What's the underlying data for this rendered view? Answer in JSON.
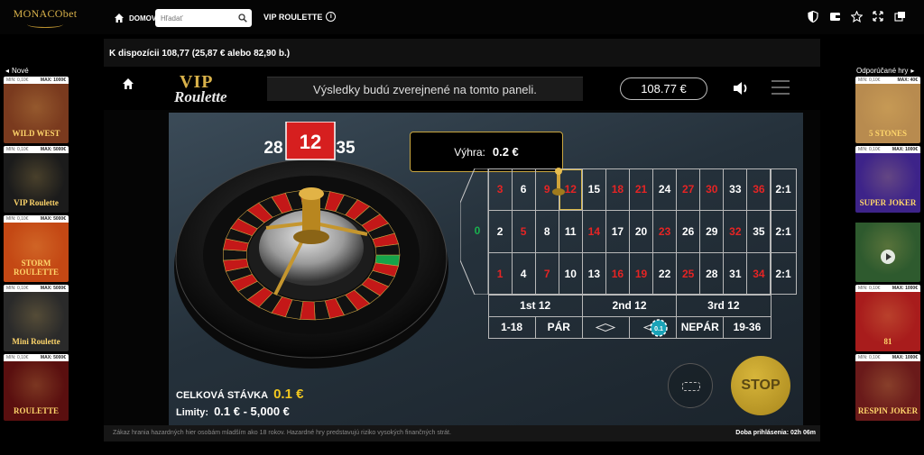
{
  "topbar": {
    "logo_text": "MONACObet",
    "home_label": "DOMOV",
    "search_placeholder": "Hľadať",
    "game_title": "VIP ROULETTE",
    "info_glyph": "i"
  },
  "balance_bar": {
    "text": "K dispozícii 108,77 (25,87 € alebo 82,90 b.)"
  },
  "left_rail": {
    "heading": "Nové",
    "tiles": [
      {
        "min": "MIN: 0,10€",
        "max": "MAX: 1000€",
        "title": "WILD WEST",
        "bg": "#7a3a1e"
      },
      {
        "min": "MIN: 0,10€",
        "max": "MAX: 5000€",
        "title": "VIP Roulette",
        "bg": "#1b1b1b"
      },
      {
        "min": "MIN: 0,10€",
        "max": "MAX: 5000€",
        "title": "STORM ROULETTE",
        "bg": "#c44814"
      },
      {
        "min": "MIN: 0,10€",
        "max": "MAX: 5000€",
        "title": "Mini Roulette",
        "bg": "#2a2a2a"
      },
      {
        "min": "MIN: 0,10€",
        "max": "MAX: 5000€",
        "title": "ROULETTE",
        "bg": "#5a0f0f"
      }
    ]
  },
  "right_rail": {
    "heading": "Odporúčané hry",
    "tiles": [
      {
        "min": "MIN: 0,10€",
        "max": "MAX: 40€",
        "title": "5 STONES",
        "bg": "#b88b4f"
      },
      {
        "min": "MIN: 0,10€",
        "max": "MAX: 1000€",
        "title": "SUPER JOKER",
        "bg": "#3d2389"
      },
      {
        "min": "",
        "max": "",
        "title": "",
        "bg": "#2e5a2e"
      },
      {
        "min": "MIN: 0,10€",
        "max": "MAX: 1000€",
        "title": "81",
        "bg": "#a81c1c"
      },
      {
        "min": "MIN: 0,10€",
        "max": "MAX: 1000€",
        "title": "RESPIN JOKER",
        "bg": "#6a1a1a"
      }
    ]
  },
  "game": {
    "logo_line1": "VIP",
    "logo_line2": "Roulette",
    "message": "Výsledky budú zverejnené na tomto paneli.",
    "balance": "108.77 €",
    "win_label": "Výhra:",
    "win_value": "0.2 €",
    "last_number": "12",
    "prev_number": "28",
    "next_number": "35",
    "total_bet_label": "CELKOVÁ STÁVKA",
    "total_bet_value": "0.1 €",
    "limits_label": "Limity:",
    "limits_value": "0.1 € - 5,000 €",
    "stop_label": "STOP",
    "chip_value": "0.1"
  },
  "table": {
    "zero": "0",
    "rows": [
      [
        {
          "n": "3",
          "c": "red"
        },
        {
          "n": "6",
          "c": "black"
        },
        {
          "n": "9",
          "c": "red"
        },
        {
          "n": "12",
          "c": "red"
        },
        {
          "n": "15",
          "c": "black"
        },
        {
          "n": "18",
          "c": "red"
        },
        {
          "n": "21",
          "c": "red"
        },
        {
          "n": "24",
          "c": "black"
        },
        {
          "n": "27",
          "c": "red"
        },
        {
          "n": "30",
          "c": "red"
        },
        {
          "n": "33",
          "c": "black"
        },
        {
          "n": "36",
          "c": "red"
        }
      ],
      [
        {
          "n": "2",
          "c": "black"
        },
        {
          "n": "5",
          "c": "red"
        },
        {
          "n": "8",
          "c": "black"
        },
        {
          "n": "11",
          "c": "black"
        },
        {
          "n": "14",
          "c": "red"
        },
        {
          "n": "17",
          "c": "black"
        },
        {
          "n": "20",
          "c": "black"
        },
        {
          "n": "23",
          "c": "red"
        },
        {
          "n": "26",
          "c": "black"
        },
        {
          "n": "29",
          "c": "black"
        },
        {
          "n": "32",
          "c": "red"
        },
        {
          "n": "35",
          "c": "black"
        }
      ],
      [
        {
          "n": "1",
          "c": "red"
        },
        {
          "n": "4",
          "c": "black"
        },
        {
          "n": "7",
          "c": "red"
        },
        {
          "n": "10",
          "c": "black"
        },
        {
          "n": "13",
          "c": "black"
        },
        {
          "n": "16",
          "c": "red"
        },
        {
          "n": "19",
          "c": "red"
        },
        {
          "n": "22",
          "c": "black"
        },
        {
          "n": "25",
          "c": "red"
        },
        {
          "n": "28",
          "c": "black"
        },
        {
          "n": "31",
          "c": "black"
        },
        {
          "n": "34",
          "c": "red"
        }
      ]
    ],
    "columns": [
      "2:1",
      "2:1",
      "2:1"
    ],
    "dozens": [
      "1st 12",
      "2nd 12",
      "3rd 12"
    ],
    "evens": [
      "1-18",
      "PÁR",
      "",
      "",
      "NEPÁR",
      "19-36"
    ]
  },
  "footer": {
    "warning": "Zákaz hrania hazardných hier osobám mladším ako 18 rokov. Hazardné hry predstavujú riziko vysokých finančných strát.",
    "session": "Doba prihlásenia: 02h 06m"
  },
  "colors": {
    "gold": "#d9b24a",
    "red": "#e62424",
    "green": "#19b04e"
  }
}
